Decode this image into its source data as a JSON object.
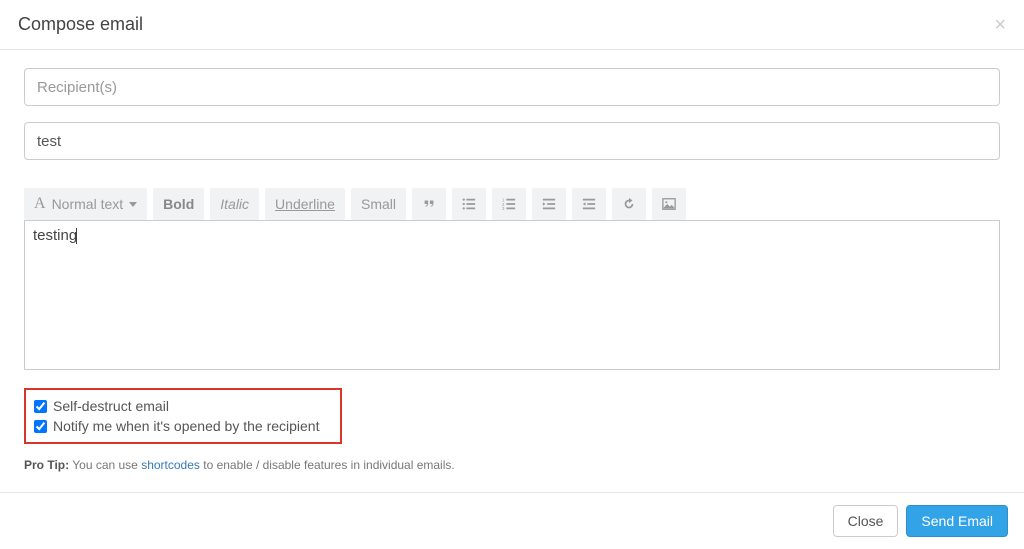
{
  "header": {
    "title": "Compose email"
  },
  "form": {
    "recipients_placeholder": "Recipient(s)",
    "subject_value": "test",
    "body_text": "testing"
  },
  "toolbar": {
    "font_label": "Normal text",
    "bold": "Bold",
    "italic": "Italic",
    "underline": "Underline",
    "small": "Small"
  },
  "options": {
    "self_destruct": "Self-destruct email",
    "notify_open": "Notify me when it's opened by the recipient"
  },
  "tip": {
    "label": "Pro Tip:",
    "prefix": " You can use ",
    "link": "shortcodes",
    "suffix": " to enable / disable features in individual emails."
  },
  "footer": {
    "close": "Close",
    "send": "Send Email"
  }
}
